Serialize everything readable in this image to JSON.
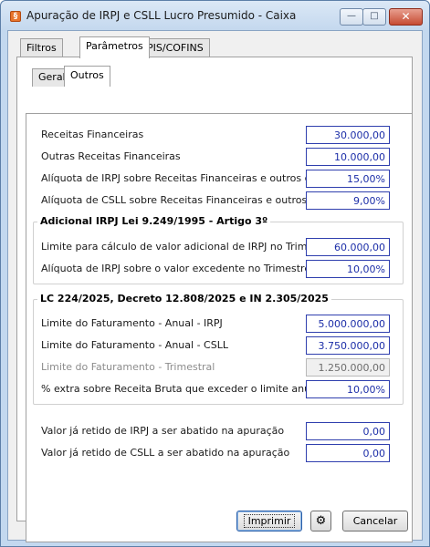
{
  "window": {
    "title": "Apuração de IRPJ e CSLL Lucro Presumido - Caixa",
    "app_icon_glyph": "§",
    "controls": {
      "minimize": "—",
      "maximize": "□",
      "close": "✕"
    }
  },
  "tabs": [
    "Filtros",
    "Parâmetros",
    "PIS/COFINS"
  ],
  "active_tab": "Parâmetros",
  "subtabs": [
    "Geral",
    "Outros"
  ],
  "active_subtab": "Outros",
  "fields": {
    "receitas_financeiras": {
      "label": "Receitas Financeiras",
      "value": "30.000,00"
    },
    "outras_receitas": {
      "label": "Outras Receitas Financeiras",
      "value": "10.000,00"
    },
    "aliq_irpj": {
      "label": "Alíquota de IRPJ sobre Receitas Financeiras e outros ganhos",
      "value": "15,00%"
    },
    "aliq_csll": {
      "label": "Alíquota de CSLL sobre Receitas Financeiras e outros ganhos",
      "value": "9,00%"
    }
  },
  "adicional": {
    "title": "Adicional IRPJ Lei 9.249/1995 - Artigo 3º",
    "limite": {
      "label": "Limite para cálculo de valor adicional de IRPJ no Trimestre",
      "value": "60.000,00"
    },
    "aliquota": {
      "label": "Alíquota de IRPJ sobre o valor excedente no Trimestre",
      "value": "10,00%"
    }
  },
  "lc": {
    "title": "LC 224/2025, Decreto 12.808/2025 e IN 2.305/2025",
    "irpj": {
      "label": "Limite do Faturamento - Anual - IRPJ",
      "value": "5.000.000,00"
    },
    "csll": {
      "label": "Limite do Faturamento - Anual - CSLL",
      "value": "3.750.000,00"
    },
    "trimestral": {
      "label": "Limite do Faturamento - Trimestral",
      "value": "1.250.000,00"
    },
    "extra": {
      "label": "% extra sobre Receita Bruta que exceder o limite anual",
      "value": "10,00%"
    }
  },
  "retidos": {
    "irpj": {
      "label": "Valor já retido de IRPJ a ser abatido na apuração",
      "value": "0,00"
    },
    "csll": {
      "label": "Valor já retido de CSLL a ser abatido na apuração",
      "value": "0,00"
    }
  },
  "buttons": {
    "imprimir": "Imprimir",
    "settings_glyph": "⚙",
    "cancelar": "Cancelar"
  },
  "colors": {
    "value_text": "#1c2ea8",
    "field_border": "#2f3fae",
    "close_button": "#c64b32"
  }
}
